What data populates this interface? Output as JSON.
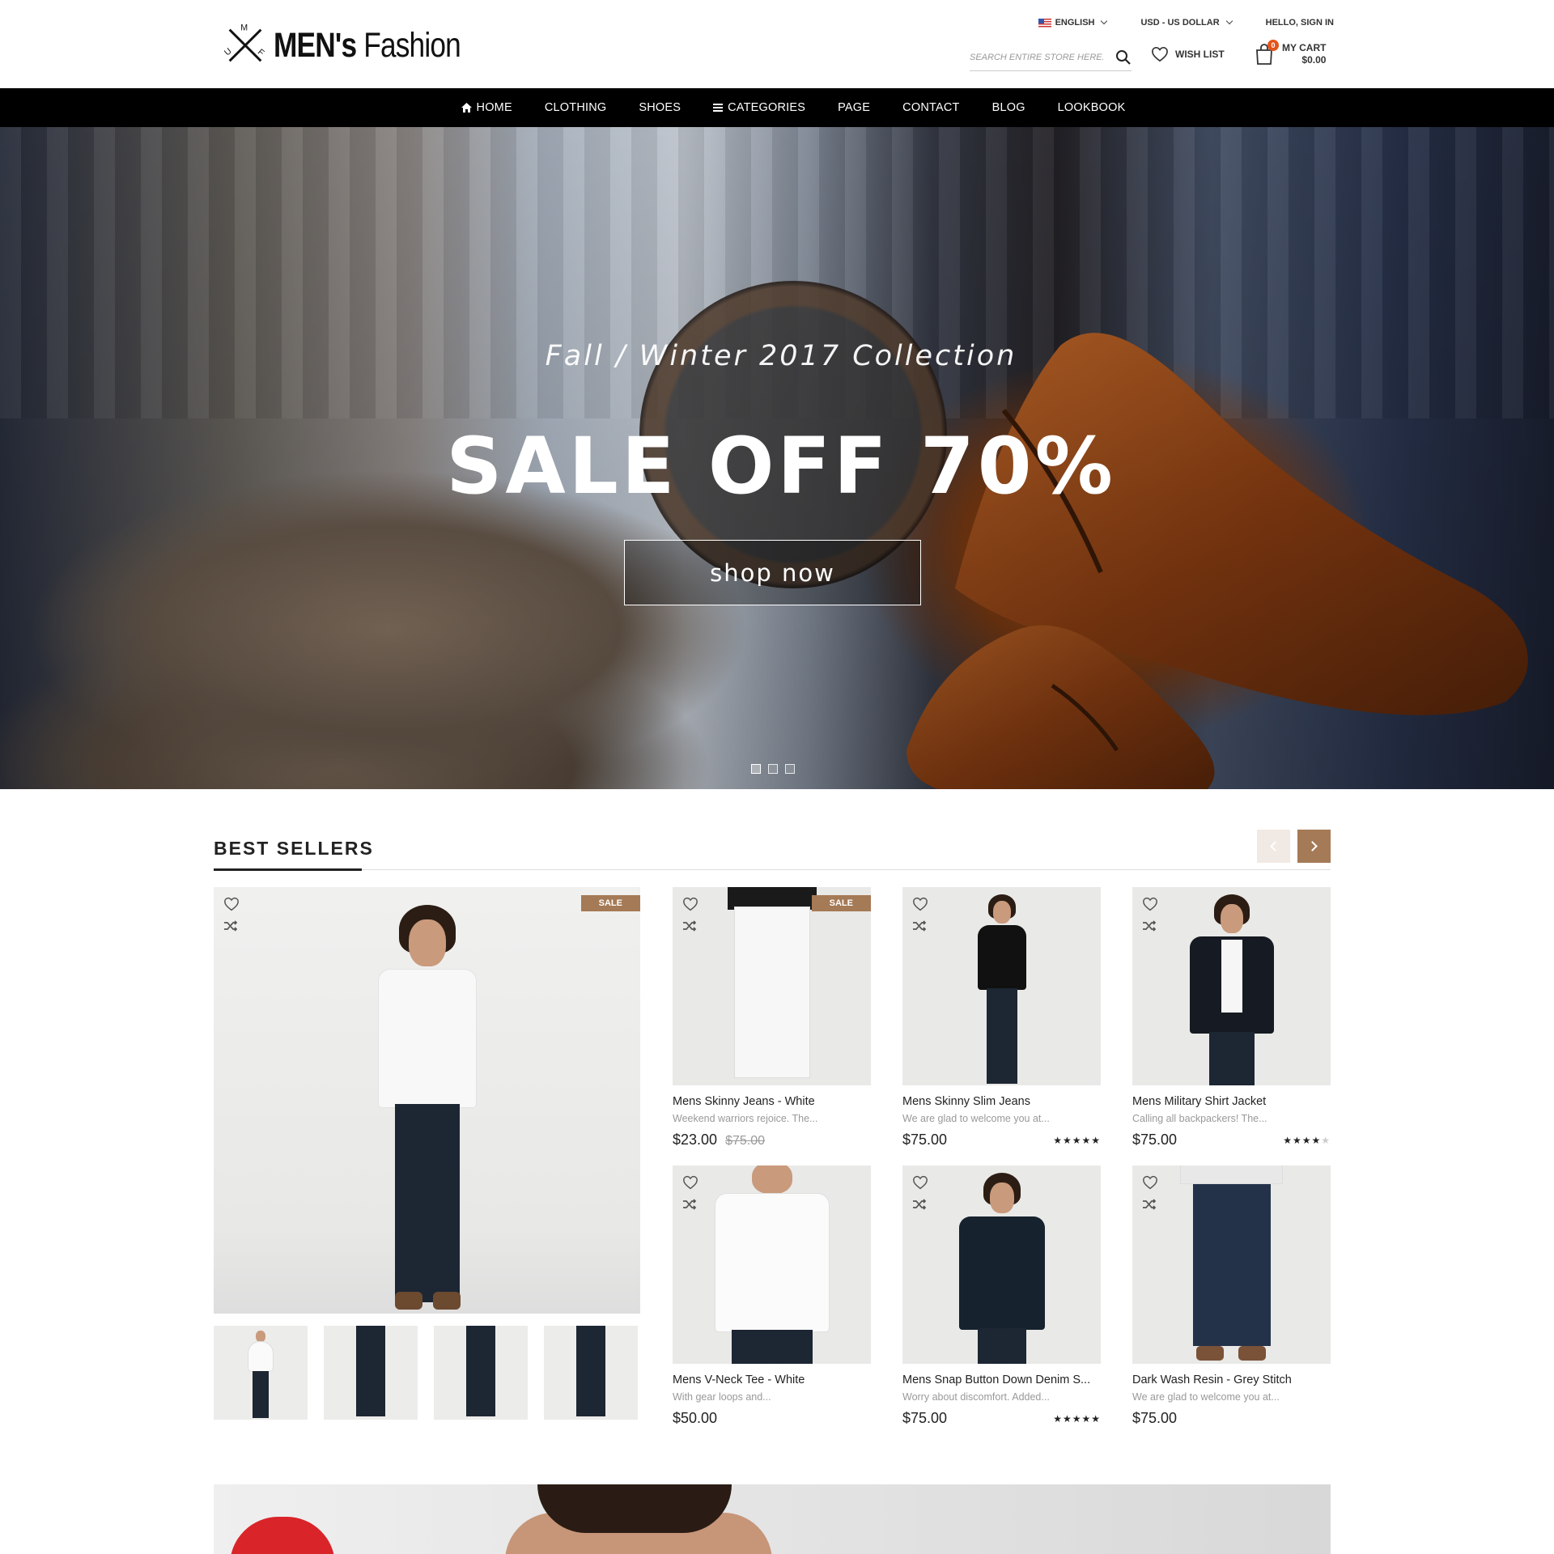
{
  "header": {
    "logo_brand_bold": "MEN's",
    "logo_brand_light": "Fashion",
    "logo_mark_letters": "UMF",
    "language": "ENGLISH",
    "currency": "USD - US DOLLAR",
    "sign_in": "HELLO, SIGN IN",
    "search_placeholder": "SEARCH ENTIRE STORE HERE...",
    "wishlist": "WISH LIST",
    "cart_label": "MY CART",
    "cart_total": "$0.00",
    "cart_count": "0",
    "icons": [
      "flag-us-icon",
      "chevron-down-icon",
      "search-icon",
      "heart-icon",
      "shopping-bag-icon"
    ]
  },
  "nav": {
    "items": [
      "HOME",
      "CLOTHING",
      "SHOES",
      "CATEGORIES",
      "PAGE",
      "CONTACT",
      "BLOG",
      "LOOKBOOK"
    ],
    "icons": [
      "home-icon",
      "menu-icon"
    ]
  },
  "hero": {
    "subtitle": "Fall / Winter 2017 Collection",
    "headline": "SALE OFF 70%",
    "cta": "shop now",
    "slides": 3,
    "active_slide": 1
  },
  "best_sellers": {
    "title": "BEST SELLERS",
    "sale_badge": "SALE",
    "accent_color": "#a57a56",
    "featured": {
      "badge": "SALE",
      "thumbnail_count": 4
    },
    "products": [
      {
        "name": "Mens Skinny Jeans - White",
        "desc": "Weekend warriors rejoice. The...",
        "price": "$23.00",
        "old_price": "$75.00",
        "rating": 0,
        "sale": true
      },
      {
        "name": "Mens Skinny Slim Jeans",
        "desc": "We are glad to welcome you at...",
        "price": "$75.00",
        "old_price": "",
        "rating": 5,
        "sale": false
      },
      {
        "name": "Mens Military Shirt Jacket",
        "desc": "Calling all backpackers! The...",
        "price": "$75.00",
        "old_price": "",
        "rating": 4,
        "sale": false
      },
      {
        "name": "Mens V-Neck Tee - White",
        "desc": "With gear loops and...",
        "price": "$50.00",
        "old_price": "",
        "rating": 0,
        "sale": false
      },
      {
        "name": "Mens Snap Button Down Denim S...",
        "desc": "Worry about discomfort. Added...",
        "price": "$75.00",
        "old_price": "",
        "rating": 5,
        "sale": false
      },
      {
        "name": "Dark Wash Resin - Grey Stitch",
        "desc": "We are glad to welcome you at...",
        "price": "$75.00",
        "old_price": "",
        "rating": 0,
        "sale": false
      }
    ]
  }
}
